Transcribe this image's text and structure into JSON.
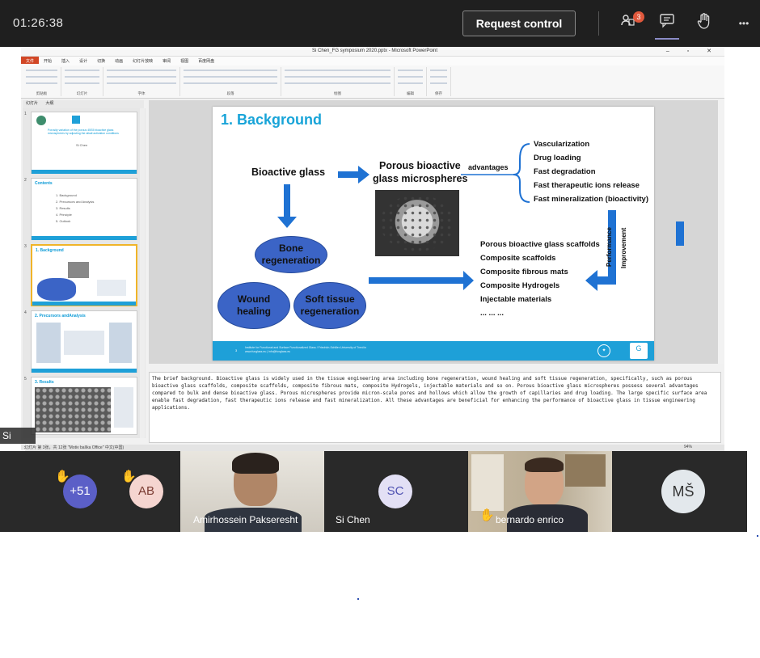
{
  "meeting": {
    "timer": "01:26:38",
    "request_control_label": "Request control",
    "participants_badge": "3",
    "participants_icon": "people-icon",
    "chat_icon": "chat-icon",
    "raise_hand_icon": "raise-hand-icon",
    "more_icon": "more-options-icon",
    "more_glyph": "•••"
  },
  "ppt": {
    "window_title": "Si Chen_FG symposium 2020.pptx - Microsoft PowerPoint",
    "tabs": [
      "文件",
      "开始",
      "插入",
      "设计",
      "切换",
      "动画",
      "幻灯片放映",
      "审阅",
      "视图",
      "百度网盘"
    ],
    "ribbon_groups": [
      "剪贴板",
      "幻灯片",
      "字体",
      "段落",
      "绘图",
      "编辑",
      "保存"
    ],
    "outline_tabs": [
      "幻灯片",
      "大纲"
    ],
    "thumbnails": [
      {
        "num": "1",
        "title": "Porosity variation of the porous 45S5 bioactive glass microspheres by adjusting the alkali activation conditions",
        "sub": "Si Chen"
      },
      {
        "num": "2",
        "title": "Contents",
        "items": [
          "1. Background",
          "2. Precursors and Analysis",
          "3. Results",
          "4. Principle",
          "5. Outlook"
        ]
      },
      {
        "num": "3",
        "title": "1. Background"
      },
      {
        "num": "4",
        "title": "2. Precursors andAnalysis"
      },
      {
        "num": "5",
        "title": "3. Results"
      }
    ],
    "slide": {
      "title": "1. Background",
      "bioactive_glass": "Bioactive glass",
      "porous_line1": "Porous bioactive",
      "porous_line2": "glass microspheres",
      "advantages_label": "advantages",
      "advantages": [
        "Vascularization",
        "Drug loading",
        "Fast degradation",
        "Fast therapeutic ions release",
        "Fast mineralization (bioactivity)"
      ],
      "bone_line1": "Bone",
      "bone_line2": "regeneration",
      "wound_line1": "Wound",
      "wound_line2": "healing",
      "soft_line1": "Soft tissue",
      "soft_line2": "regeneration",
      "applications": [
        "Porous bioactive glass scaffolds",
        "Composite scaffolds",
        "Composite fibrous mats",
        "Composite Hydrogels",
        "Injectable materials",
        "... ... ..."
      ],
      "performance_label": "Performance",
      "improvement_label": "Improvement",
      "footer_page": "3",
      "footer_line1": "Institute for Functional and Surface Functionalized Glass / Friedrich-Schiller-University of Trenčín",
      "footer_line2": "www.funglass.eu | info@funglass.eu",
      "accent": "#18a4d8",
      "arrow_color": "#1f72d3",
      "ellipse_color": "#3b64c6"
    },
    "notes": "The brief background. Bioactive glass is widely used in the tissue engineering area including bone regeneration, wound healing and soft tissue regeneration, specifically, such as porous bioactive glass scaffolds, composite scaffolds, composite fibrous mats, composite Hydrogels, injectable materials and so on. Porous bioactive glass microspheres possess several advantages compared to bulk and dense bioactive glass. Porous microspheres provide micron-scale pores and hollows which allow the growth of capillaries and drug loading. The large specific surface area enable fast degradation, fast therapeutic ions release and fast mineralization. All these advantages are beneficial for enhancing the performance of bioactive glass in tissue engineering applications.",
    "status_left": "幻灯片 第 3张，共 12张   \"Motiv balíka Office\"   中文(中国)",
    "status_zoom": "94%"
  },
  "presenter_label": "Si Chen",
  "participants": [
    {
      "id": "overflow",
      "initials": "+51",
      "bg": "#5b5fc7",
      "hand": true
    },
    {
      "id": "ab",
      "initials": "AB",
      "bg": "#f5d5d0",
      "hand": true
    },
    {
      "id": "amirhossein",
      "name": "Amirhossein Pakseresht",
      "hand": false
    },
    {
      "id": "sichen",
      "initials": "SC",
      "name": "Si Chen",
      "bg": "#e3e0f5",
      "hand": false
    },
    {
      "id": "bernardo",
      "name": "bernardo enrico",
      "hand": true
    },
    {
      "id": "ms",
      "initials": "MŠ",
      "bg": "#e3e8ec",
      "hand": false
    }
  ]
}
